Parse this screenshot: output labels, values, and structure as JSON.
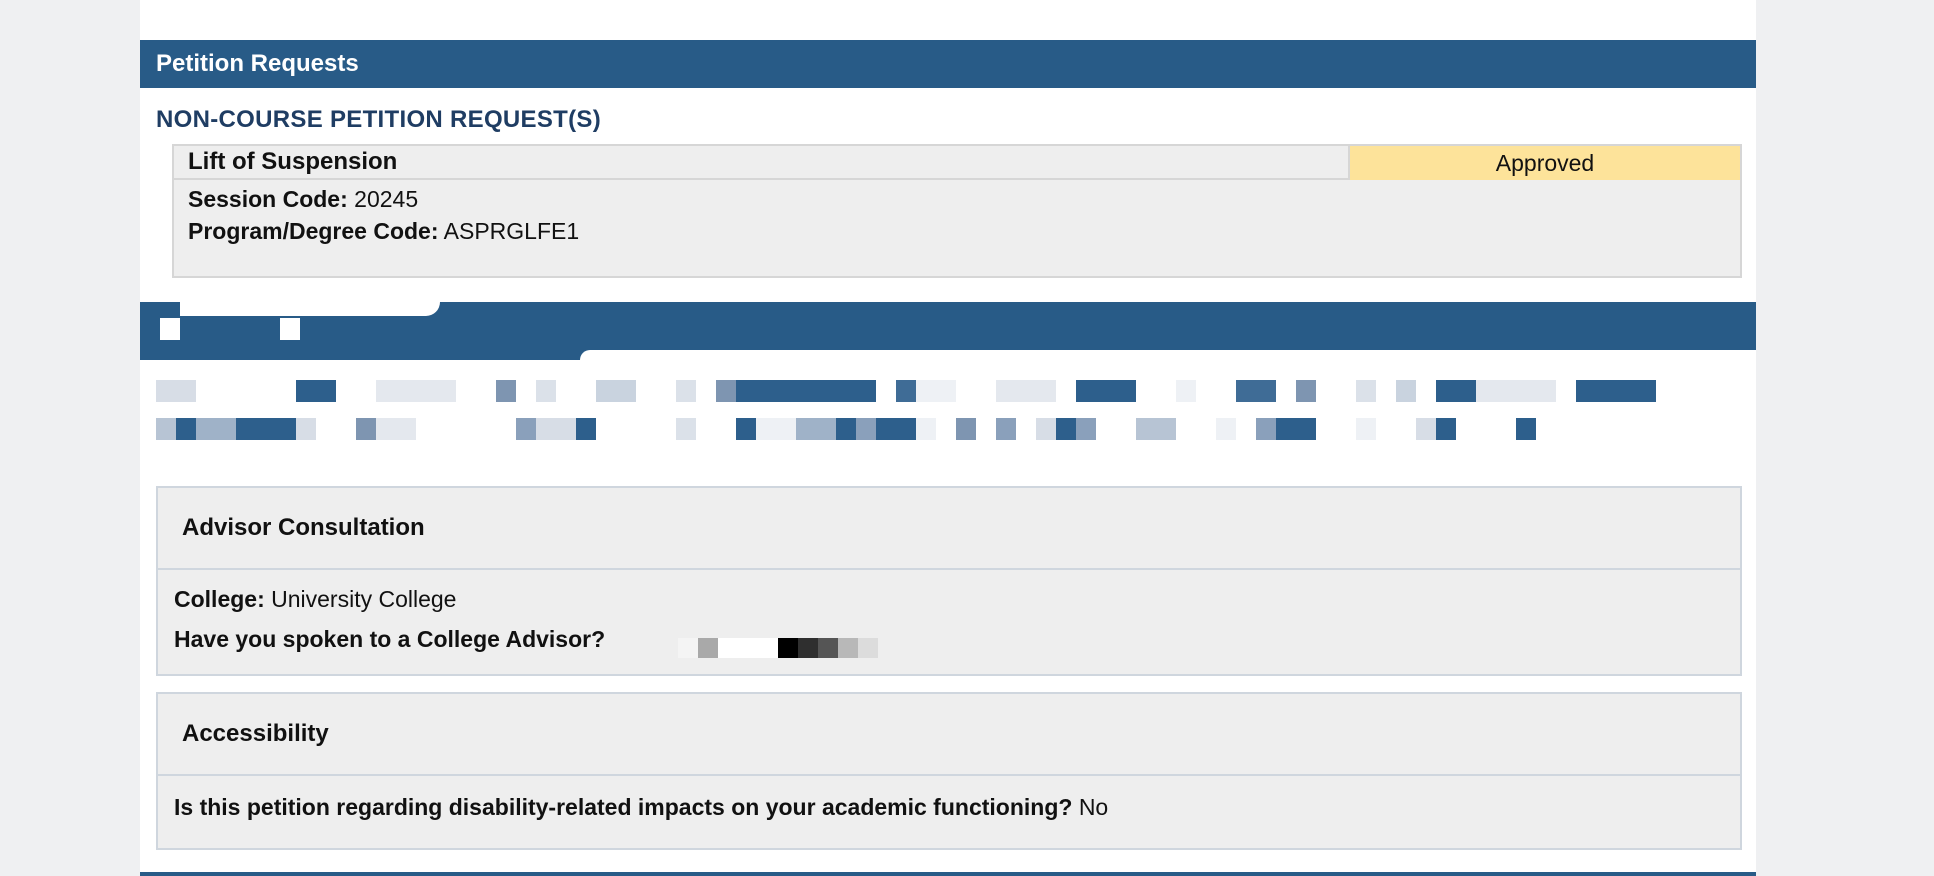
{
  "section": {
    "title": "Petition Requests",
    "subheading": "NON-COURSE PETITION REQUEST(S)"
  },
  "petition": {
    "type": "Lift of Suspension",
    "status": "Approved",
    "session_code_label": "Session Code:",
    "session_code": "20245",
    "program_code_label": "Program/Degree Code:",
    "program_code": "ASPRGLFE1"
  },
  "advisor_consultation": {
    "title": "Advisor Consultation",
    "college_label": "College:",
    "college_value": "University College",
    "spoken_label": "Have you spoken to a College Advisor?"
  },
  "accessibility": {
    "title": "Accessibility",
    "question_label": "Is this petition regarding disability-related impacts on your academic functioning?",
    "answer": "No"
  },
  "colors": {
    "header_blue": "#285b87",
    "status_approved": "#fde39a",
    "subheading_navy": "#1f3d63"
  }
}
